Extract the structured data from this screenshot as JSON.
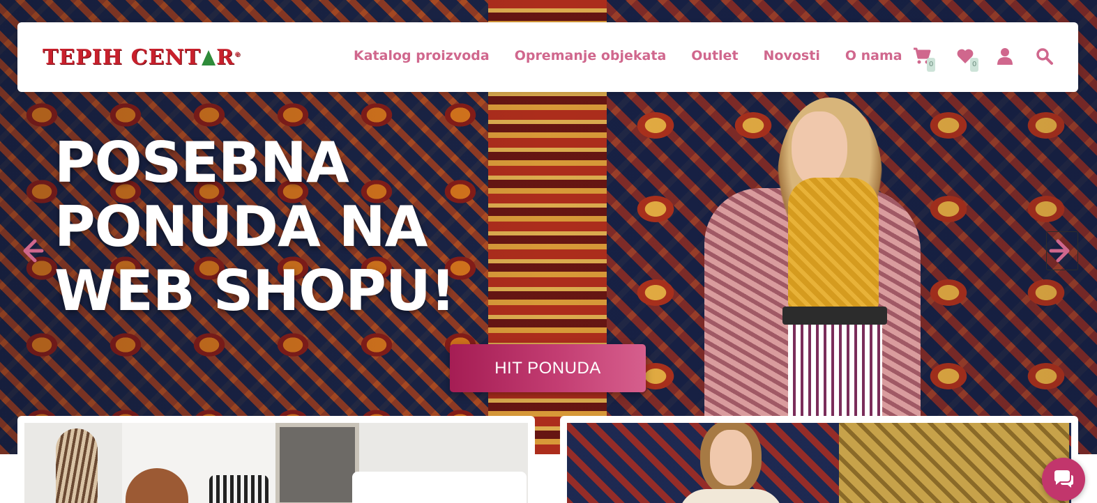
{
  "brand": {
    "logo_text_1": "TEPIH CENT",
    "logo_text_2": "R",
    "logo_tm": "®",
    "primary_color": "#d0678d",
    "logo_color": "#c8202c",
    "button_color": "#b52a60"
  },
  "nav": {
    "items": [
      {
        "label": "Katalog proizvoda"
      },
      {
        "label": "Opremanje objekata"
      },
      {
        "label": "Outlet"
      },
      {
        "label": "Novosti"
      },
      {
        "label": "O nama"
      }
    ]
  },
  "header_icons": {
    "cart": {
      "icon": "cart-icon",
      "count": "0"
    },
    "wishlist": {
      "icon": "heart-icon",
      "count": "0"
    },
    "account": {
      "icon": "user-icon"
    },
    "search": {
      "icon": "search-icon"
    }
  },
  "hero": {
    "headline_lines": [
      "POSEBNA",
      "PONUDA NA",
      "WEB SHOPU!"
    ],
    "cta_label": "HIT PONUDA",
    "prev_icon": "arrow-left-icon",
    "next_icon": "arrow-right-icon"
  },
  "chat": {
    "icon": "chat-icon"
  }
}
